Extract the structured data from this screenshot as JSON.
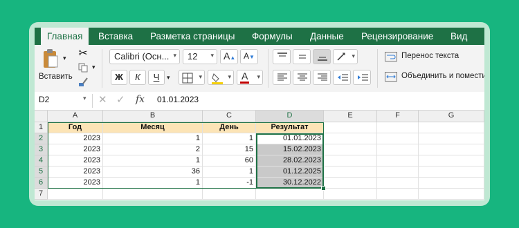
{
  "tabs": [
    "Главная",
    "Вставка",
    "Разметка страницы",
    "Формулы",
    "Данные",
    "Рецензирование",
    "Вид"
  ],
  "ribbon": {
    "paste_label": "Вставить",
    "font_name": "Calibri (Осн...",
    "font_size": "12",
    "bold": "Ж",
    "italic": "К",
    "underline": "Ч",
    "grow_font": "A",
    "shrink_font": "A",
    "font_color_letter": "A",
    "wrap_text": "Перенос текста",
    "merge_center": "Объединить и поместить"
  },
  "formula_bar": {
    "name_box": "D2",
    "fx": "fx",
    "value": "01.01.2023"
  },
  "columns": [
    "A",
    "B",
    "C",
    "D",
    "E",
    "F",
    "G"
  ],
  "rows": [
    "1",
    "2",
    "3",
    "4",
    "5",
    "6",
    "7"
  ],
  "headers": [
    "Год",
    "Месяц",
    "День",
    "Результат"
  ],
  "data": [
    [
      "2023",
      "1",
      "1",
      "01.01.2023"
    ],
    [
      "2023",
      "2",
      "15",
      "15.02.2023"
    ],
    [
      "2023",
      "1",
      "60",
      "28.02.2023"
    ],
    [
      "2023",
      "36",
      "1",
      "01.12.2025"
    ],
    [
      "2023",
      "1",
      "-1",
      "30.12.2022"
    ]
  ],
  "colors": {
    "accent": "#1e7145",
    "background": "#17b57f",
    "header_fill": "#fce4b6",
    "selection_fill": "#c9c9c9"
  }
}
